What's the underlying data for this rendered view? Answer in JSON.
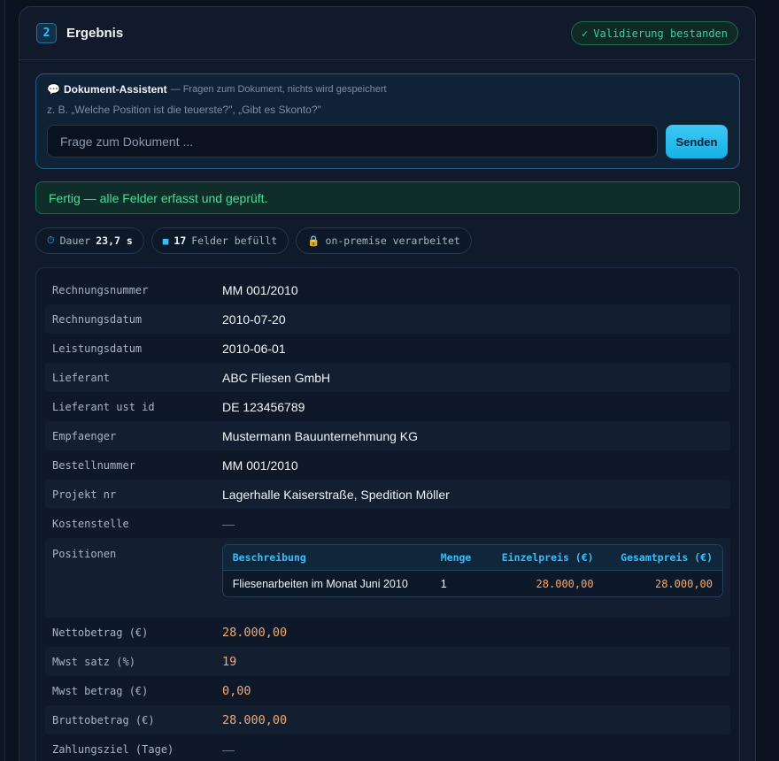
{
  "header": {
    "step_number": "2",
    "title": "Ergebnis",
    "validation_label": "Validierung bestanden",
    "validation_icon": "✓"
  },
  "assistant": {
    "icon": "💬",
    "title": "Dokument-Assistent",
    "subtitle": "— Fragen zum Dokument, nichts wird gespeichert",
    "hint": "z. B. „Welche Position ist die teuerste?\", „Gibt es Skonto?\"",
    "input_value": "",
    "input_placeholder": "Frage zum Dokument ...",
    "send_label": "Senden"
  },
  "status_banner": "Fertig — alle Felder erfasst und geprüft.",
  "chips": {
    "duration_icon": "⏱",
    "duration_label": "Dauer",
    "duration_value": "23,7 s",
    "fields_icon": "■",
    "fields_count": "17",
    "fields_label": "Felder befüllt",
    "onprem_icon": "🔒",
    "onprem_label": "on-premise verarbeitet"
  },
  "fields": [
    {
      "label": "Rechnungsnummer",
      "value": "MM 001/2010"
    },
    {
      "label": "Rechnungsdatum",
      "value": "2010-07-20"
    },
    {
      "label": "Leistungsdatum",
      "value": "2010-06-01"
    },
    {
      "label": "Lieferant",
      "value": "ABC Fliesen GmbH"
    },
    {
      "label": "Lieferant ust id",
      "value": "DE 123456789"
    },
    {
      "label": "Empfaenger",
      "value": "Mustermann Bauunternehmung KG"
    },
    {
      "label": "Bestellnummer",
      "value": "MM 001/2010"
    },
    {
      "label": "Projekt nr",
      "value": "Lagerhalle Kaiserstraße, Spedition Möller"
    },
    {
      "label": "Kostenstelle",
      "value": "—"
    }
  ],
  "positions": {
    "label": "Positionen",
    "headers": [
      "Beschreibung",
      "Menge",
      "Einzelpreis (€)",
      "Gesamtpreis (€)"
    ],
    "rows": [
      [
        "Fliesenarbeiten im Monat Juni 2010",
        "1",
        "28.000,00",
        "28.000,00"
      ]
    ]
  },
  "amounts": [
    {
      "label": "Nettobetrag (€)",
      "value": "28.000,00"
    },
    {
      "label": "Mwst satz (%)",
      "value": "19"
    },
    {
      "label": "Mwst betrag (€)",
      "value": "0,00"
    },
    {
      "label": "Bruttobetrag (€)",
      "value": "28.000,00"
    },
    {
      "label": "Zahlungsziel (Tage)",
      "value": "—"
    }
  ]
}
